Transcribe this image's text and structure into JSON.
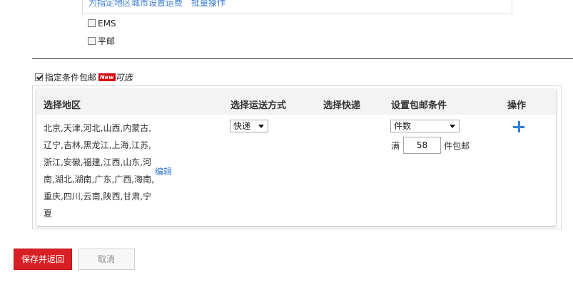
{
  "top": {
    "links": [
      "为指定地区城市设置运费",
      "批量操作"
    ]
  },
  "options": {
    "ems_label": "EMS",
    "pingyou_label": "平邮"
  },
  "free_shipping": {
    "label": "指定条件包邮",
    "badge": "New",
    "optional": "可选"
  },
  "table": {
    "headers": {
      "region": "选择地区",
      "ship_method": "选择运送方式",
      "express": "选择快递",
      "condition": "设置包邮条件",
      "action": "操作"
    },
    "row": {
      "regions": "北京,天津,河北,山西,内蒙古,辽宁,吉林,黑龙江,上海,江苏,浙江,安徽,福建,江西,山东,河南,湖北,湖南,广东,广西,海南,重庆,四川,云南,陕西,甘肃,宁夏",
      "edit": "编辑",
      "ship_method_value": "快递",
      "condition_value": "件数",
      "full_prefix": "满",
      "quantity": "58",
      "full_suffix": "件包邮"
    }
  },
  "buttons": {
    "save": "保存并返回",
    "cancel": "取消"
  },
  "colors": {
    "primary_red": "#d71f24",
    "link_blue": "#3a7bd5",
    "plus_blue": "#2f7fd8",
    "badge_red": "#d6000f"
  }
}
